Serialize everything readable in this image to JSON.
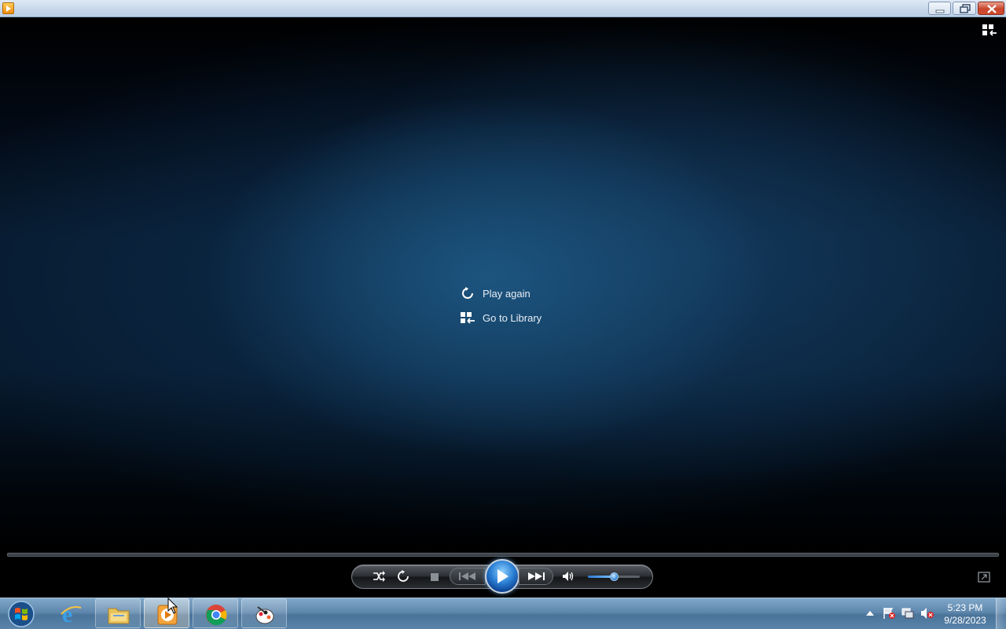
{
  "window": {
    "title": "",
    "buttons": {
      "minimize": "minimize",
      "maximize": "maximize",
      "close": "close"
    }
  },
  "player": {
    "switch_to_library_icon": "switch-to-library-icon",
    "end_menu": [
      {
        "label": "Play again",
        "icon": "replay-icon"
      },
      {
        "label": "Go to Library",
        "icon": "library-icon"
      }
    ],
    "seek_progress": 0,
    "controls": {
      "shuffle_icon": "shuffle-icon",
      "repeat_icon": "repeat-icon",
      "stop_icon": "stop-icon",
      "previous_icon": "previous-icon",
      "play_icon": "play-icon",
      "next_icon": "next-icon",
      "mute_icon": "speaker-icon",
      "volume_level": 0.5
    },
    "fullscreen_icon": "fullscreen-icon"
  },
  "taskbar": {
    "start_icon": "windows-logo-icon",
    "apps": [
      {
        "name": "internet-explorer-icon",
        "state": "pinned"
      },
      {
        "name": "file-explorer-icon",
        "state": "pinned"
      },
      {
        "name": "windows-media-player-icon",
        "state": "active"
      },
      {
        "name": "chrome-icon",
        "state": "pinned"
      },
      {
        "name": "paint-app-icon",
        "state": "pinned"
      }
    ],
    "tray": {
      "show_hidden_icon": "show-hidden-icons-arrow",
      "action_center_icon": "action-center-flag-icon",
      "network_icon": "network-icon",
      "volume_icon": "volume-muted-icon"
    },
    "clock": {
      "time": "5:23 PM",
      "date": "9/28/2023"
    }
  },
  "colors": {
    "accent": "#2a7fd4",
    "taskbar": "#5f87ad",
    "menu_text": "#e8eef5"
  }
}
